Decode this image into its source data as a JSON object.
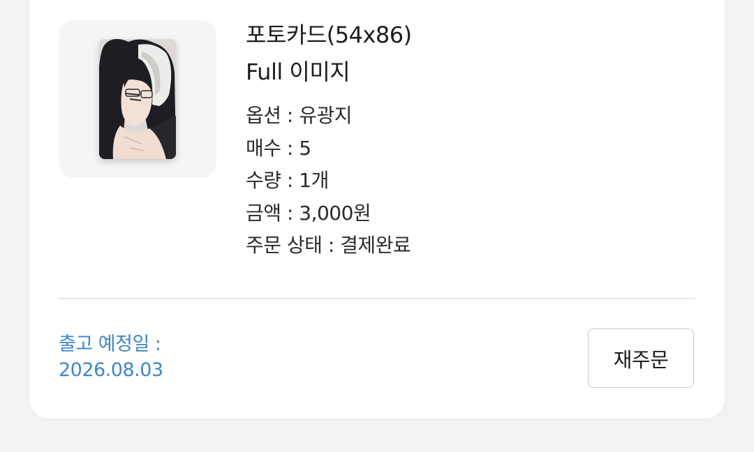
{
  "item": {
    "title": "포토카드(54x86)",
    "subtitle": "Full 이미지",
    "details": {
      "option": "옵션 : 유광지",
      "sheets": "매수 : 5",
      "quantity": "수량 : 1개",
      "amount": "금액 : 3,000원",
      "status": "주문 상태 : 결제완료"
    }
  },
  "shipping": {
    "label": "출고 예정일 :",
    "date": "2026.08.03"
  },
  "actions": {
    "reorder_label": "재주문"
  },
  "colors": {
    "accent": "#3d86c8",
    "background": "#f2f2f2",
    "card": "#ffffff"
  }
}
